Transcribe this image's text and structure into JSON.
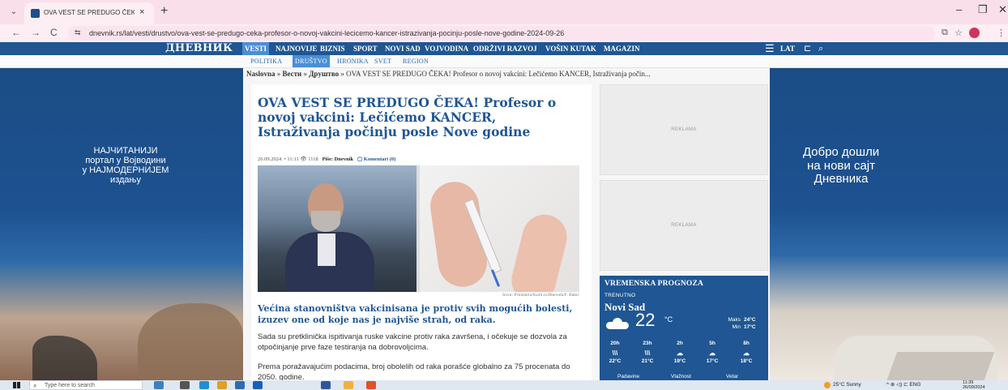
{
  "browser": {
    "tab_title": "OVA VEST SE PREDUGO ČEKA! Pr",
    "tab_close": "×",
    "new_tab": "+",
    "url": "dnevnik.rs/lat/vesti/drustvo/ova-vest-se-predugo-ceka-profesor-o-novoj-vakcini-lecicemo-kancer-istrazivanja-pocinju-posle-nove-godine-2024-09-26",
    "back": "←",
    "forward": "→",
    "reload": "C",
    "minimize": "–",
    "restore": "❐",
    "close": "✕",
    "tab_menu": "⌄",
    "site_info": "⇆",
    "cast": "⧉",
    "star": "☆",
    "more": "⋮"
  },
  "header": {
    "logo": "ДНЕВНИК",
    "nav": [
      {
        "label": "VESTI",
        "active": true
      },
      {
        "label": "NAJNOVIJE"
      },
      {
        "label": "BIZNIS"
      },
      {
        "label": "SPORT"
      },
      {
        "label": "NOVI SAD"
      },
      {
        "label": "VOJVODINA"
      },
      {
        "label": "ODRŽIVI RAZVOJ"
      },
      {
        "label": "VOŠIN KUTAK"
      },
      {
        "label": "MAGAZIN"
      }
    ],
    "menu_icon": "☰",
    "lang": "LAT",
    "bookmark_icon": "⊏",
    "search_icon": "⌕",
    "subnav": [
      {
        "label": "POLITIKA"
      },
      {
        "label": "DRUŠTVO",
        "active": true
      },
      {
        "label": "HRONIKA"
      },
      {
        "label": "SVET"
      },
      {
        "label": "REGION"
      }
    ]
  },
  "banners": {
    "left_lines": [
      "НАЈЧИТАНИЈИ",
      "портал у Војводини",
      "у НАЈМОДЕРНИЈЕМ",
      "издању"
    ],
    "right_lines": [
      "Добро дошли",
      "на нови сајт",
      "Дневника"
    ]
  },
  "breadcrumb": {
    "home": "Naslovna",
    "sep": " » ",
    "section": "Вести",
    "subsection": "Друштво",
    "current": "OVA VEST SE PREDUGO ČEKA! Profesor o novoj vakcini: Lečićemo KANCER, Istraživanja počin..."
  },
  "article": {
    "headline": "OVA VEST SE PREDUGO ČEKA! Profesor o novoj vakcini: Lečićemo KANCER, Istraživanja počinju posle Nove godine",
    "date": "26.09.2024.",
    "time": "11:11",
    "views_icon": "👁",
    "views": "1118",
    "author_label": "Piše:",
    "author": "Dnevnik",
    "comments_icon": "▢",
    "comments": "Komentari (0)",
    "photo_credit": "Izvor: Printskrin/Kurir.rs/Dnevnik/F. Bakić",
    "lead": "Većina stanovništva vakcinisana je protiv svih mogućih bolesti, izuzev one od koje nas je najviše strah, od raka.",
    "paragraphs": [
      "Sada su pretklinička ispitivanja ruske vakcine protiv raka završena, i očekuje se dozvola za otpočinjanje prve faze testiranja na dobrovoljcima.",
      "Prema poražavajućim podacima, broj obolelih od raka porašće globalno za 75 procenata do 2050. godine."
    ]
  },
  "ads": {
    "label": "REKLAMA"
  },
  "weather": {
    "title": "VREMENSKA PROGNOZA",
    "current_label": "TRENUTNO",
    "city": "Novi Sad",
    "temp": "22",
    "unit": "°C",
    "max_label": "Maks",
    "max": "24°C",
    "min_label": "Min",
    "min": "17°C",
    "forecast": [
      {
        "hour": "20h",
        "icon": "rain-icon",
        "glyph": "\\\\\\",
        "temp": "22°C"
      },
      {
        "hour": "23h",
        "icon": "rain-icon",
        "glyph": "\\\\\\",
        "temp": "21°C"
      },
      {
        "hour": "2h",
        "icon": "cloud-icon",
        "glyph": "☁",
        "temp": "19°C"
      },
      {
        "hour": "5h",
        "icon": "cloud-icon",
        "glyph": "☁",
        "temp": "17°C"
      },
      {
        "hour": "8h",
        "icon": "cloud-icon",
        "glyph": "☁",
        "temp": "18°C"
      }
    ],
    "tabs": [
      "Padavine",
      "Vlažnost",
      "Vetar"
    ]
  },
  "taskbar": {
    "search_placeholder": "Type here to search",
    "search_icon": "⌕",
    "weather": "25°C  Sunny",
    "tray": "^  ⊕  ◁)  ⊏  ENG",
    "time": "11:39",
    "date": "26/09/2024",
    "app_colors": [
      "#3b82c4",
      "#555555",
      "#1e8fd6",
      "#e0a020",
      "#2b6cb0",
      "#1560bd",
      "#2b579a",
      "#f0b040",
      "#e34f26"
    ]
  }
}
